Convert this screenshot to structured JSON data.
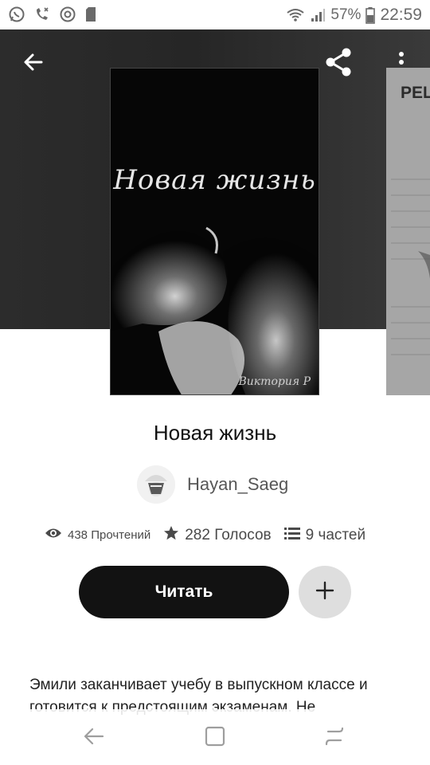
{
  "status_bar": {
    "battery": "57%",
    "time": "22:59"
  },
  "cover": {
    "title": "Новая жизнь",
    "author": "Виктория Р"
  },
  "next_cover": {
    "partial_title": "РЕШ"
  },
  "book": {
    "title": "Новая жизнь",
    "author": "Hayan_Saeg"
  },
  "stats": {
    "reads": "438 Прочтений",
    "votes": "282 Голосов",
    "parts": "9 частей"
  },
  "actions": {
    "read_label": "Читать"
  },
  "description": "Эмили заканчивает учебу в выпускном классе и готовится к предстоящим экзаменам. Не",
  "icons": {
    "back": "arrow-left-icon",
    "share": "share-icon",
    "more": "more-vert-icon",
    "views": "eye-icon",
    "votes": "star-icon",
    "parts": "list-icon",
    "add": "plus-icon"
  },
  "colors": {
    "primary_button": "#121212",
    "secondary_button": "#dedede",
    "hero_background": "#2c2c2c"
  }
}
